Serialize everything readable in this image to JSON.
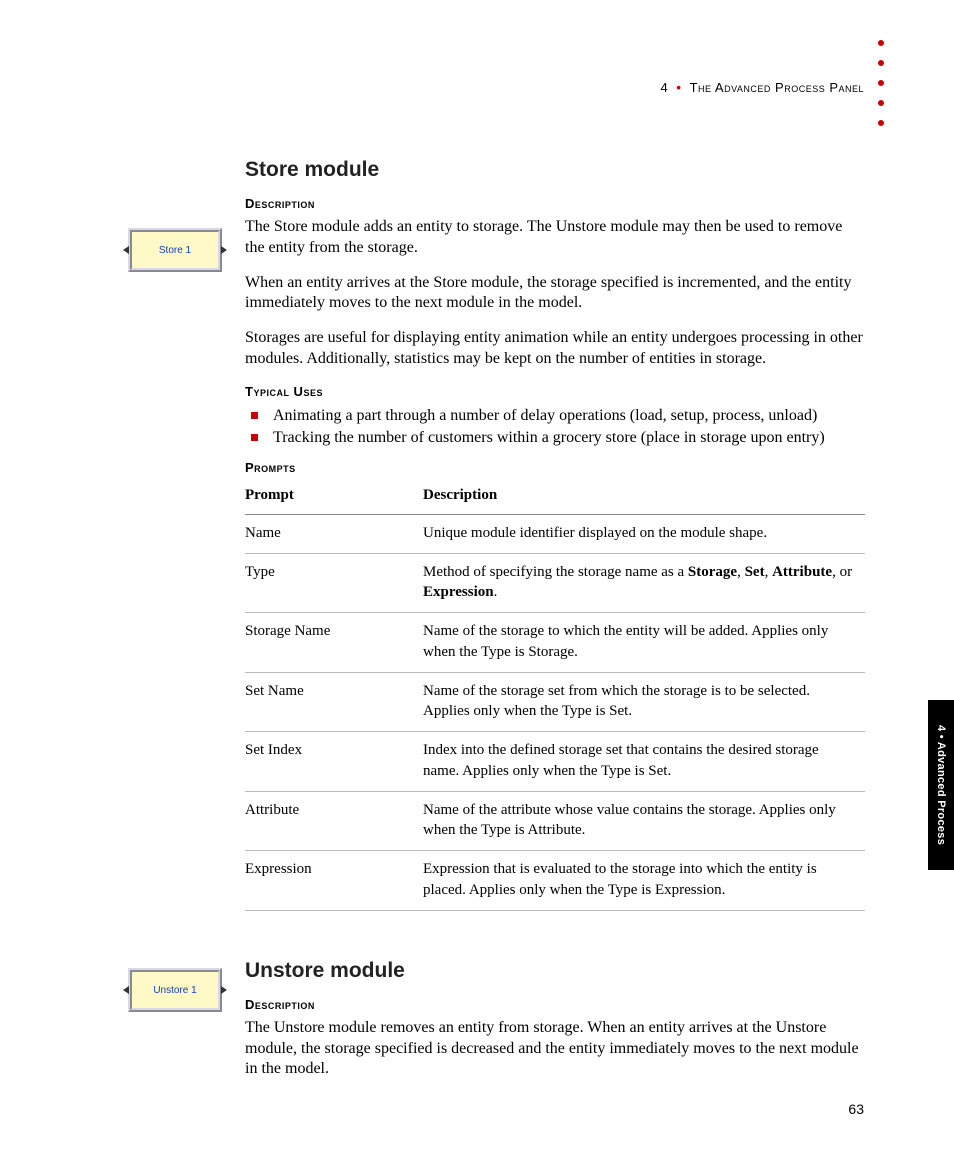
{
  "header": {
    "chapter_num": "4",
    "chapter_title": "The Advanced Process Panel"
  },
  "side_tab": "4 • Advanced Process",
  "page_number": "63",
  "store": {
    "icon_label": "Store 1",
    "title": "Store module",
    "desc_head": "Description",
    "p1": "The Store module adds an entity to storage. The Unstore module may then be used to remove the entity from the storage.",
    "p2": "When an entity arrives at the Store module, the storage specified is incremented, and the entity immediately moves to the next module in the model.",
    "p3": "Storages are useful for displaying entity animation while an entity undergoes processing in other modules. Additionally, statistics may be kept on the number of entities in storage.",
    "uses_head": "Typical Uses",
    "uses": [
      "Animating a part through a number of delay operations (load, setup, process, unload)",
      "Tracking the number of customers within a grocery store (place in storage upon entry)"
    ],
    "prompts_head": "Prompts",
    "th_prompt": "Prompt",
    "th_desc": "Description",
    "rows": [
      {
        "p": "Name",
        "d": "Unique module identifier displayed on the module shape."
      },
      {
        "p": "Type",
        "d_pre": "Method of specifying the storage name as a ",
        "b1": "Storage",
        "s1": ", ",
        "b2": "Set",
        "s2": ", ",
        "b3": "Attribute",
        "s3": ", or ",
        "b4": "Expression",
        "s4": "."
      },
      {
        "p": "Storage Name",
        "d": "Name of the storage to which the entity will be added. Applies only when the Type is Storage."
      },
      {
        "p": "Set Name",
        "d": "Name of the storage set from which the storage is to be selected. Applies only when the Type is Set."
      },
      {
        "p": "Set Index",
        "d": "Index into the defined storage set that contains the desired storage name. Applies only when the Type is Set."
      },
      {
        "p": "Attribute",
        "d": "Name of the attribute whose value contains the storage. Applies only when the Type is Attribute."
      },
      {
        "p": "Expression",
        "d": "Expression that is evaluated to the storage into which the entity is placed. Applies only when the Type is Expression."
      }
    ]
  },
  "unstore": {
    "icon_label": "Unstore 1",
    "title": "Unstore module",
    "desc_head": "Description",
    "p1": "The Unstore module removes an entity from storage. When an entity arrives at the Unstore module, the storage specified is decreased and the entity immediately moves to the next module in the model."
  }
}
